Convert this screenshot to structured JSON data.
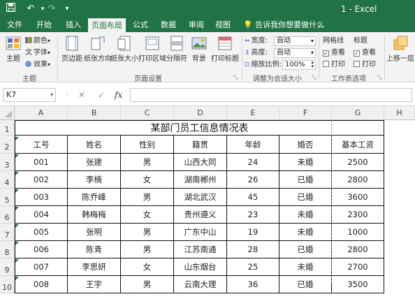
{
  "app": {
    "window_title": "1 - Excel"
  },
  "quick_access": {
    "save": "save-icon",
    "undo": "↶",
    "redo": "↷",
    "customize": "▾"
  },
  "tabs": [
    {
      "label": "文件",
      "active": false
    },
    {
      "label": "开始",
      "active": false
    },
    {
      "label": "插入",
      "active": false
    },
    {
      "label": "页面布局",
      "active": true
    },
    {
      "label": "公式",
      "active": false
    },
    {
      "label": "数据",
      "active": false
    },
    {
      "label": "审阅",
      "active": false
    },
    {
      "label": "视图",
      "active": false
    }
  ],
  "tell_me": "告诉我你想要做什么",
  "ribbon": {
    "themes": {
      "theme": "主题",
      "colors": "颜色",
      "fonts": "字体",
      "effects": "效果",
      "group": "主题"
    },
    "page_setup": {
      "margins": "页边距",
      "orientation": "纸张方向",
      "size": "纸张大小",
      "print_area": "打印区域",
      "breaks": "分隔符",
      "background": "背景",
      "print_titles": "打印标题",
      "group": "页面设置"
    },
    "scale": {
      "width_label": "宽度:",
      "width_value": "自动",
      "height_label": "高度:",
      "height_value": "自动",
      "scale_label": "缩放比例:",
      "scale_value": "100%",
      "group": "调整为合适大小"
    },
    "sheet_options": {
      "gridlines": "网格线",
      "headings": "标题",
      "view": "查看",
      "print": "打印",
      "gridlines_view": true,
      "gridlines_print": false,
      "headings_view": true,
      "headings_print": false,
      "group": "工作表选项"
    },
    "arrange": {
      "bring_forward": "上移一层"
    }
  },
  "name_box": "K7",
  "formula_bar": {
    "cancel": "✕",
    "enter": "✓",
    "fx": "fx",
    "value": ""
  },
  "columns": [
    "A",
    "B",
    "C",
    "D",
    "E",
    "F",
    "G",
    "H"
  ],
  "rows": [
    "1",
    "2",
    "3",
    "4",
    "5",
    "6",
    "7",
    "8",
    "9",
    "10"
  ],
  "sheet": {
    "title": "某部门员工信息情况表",
    "headers": [
      "工号",
      "姓名",
      "性别",
      "籍贯",
      "年龄",
      "婚否",
      "基本工资"
    ],
    "data": [
      [
        "001",
        "张建",
        "男",
        "山西大同",
        "24",
        "未婚",
        "2500"
      ],
      [
        "002",
        "李楠",
        "女",
        "湖南郴州",
        "26",
        "已婚",
        "2800"
      ],
      [
        "003",
        "陈乔峰",
        "男",
        "湖北武汉",
        "45",
        "已婚",
        "3600"
      ],
      [
        "004",
        "韩梅梅",
        "女",
        "贵州遵义",
        "23",
        "未婚",
        "2300"
      ],
      [
        "005",
        "张明",
        "男",
        "广东中山",
        "19",
        "未婚",
        "1000"
      ],
      [
        "006",
        "陈青",
        "男",
        "江苏南通",
        "28",
        "已婚",
        "2800"
      ],
      [
        "007",
        "李思妍",
        "女",
        "山东烟台",
        "25",
        "未婚",
        "2700"
      ],
      [
        "008",
        "王宇",
        "男",
        "云南大理",
        "36",
        "已婚",
        "3500"
      ]
    ]
  },
  "colors": {
    "excel_green": "#217346"
  }
}
